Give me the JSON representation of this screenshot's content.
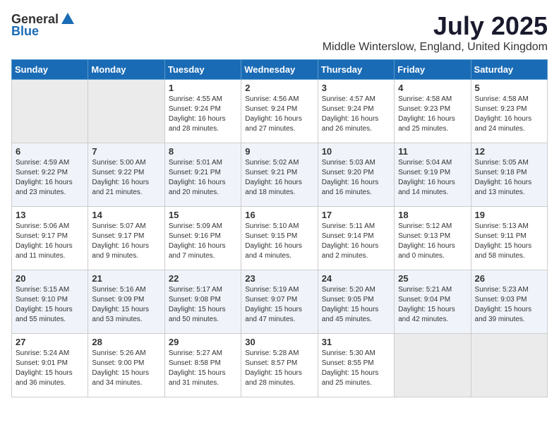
{
  "header": {
    "logo_general": "General",
    "logo_blue": "Blue",
    "month_title": "July 2025",
    "location": "Middle Winterslow, England, United Kingdom"
  },
  "calendar": {
    "days_of_week": [
      "Sunday",
      "Monday",
      "Tuesday",
      "Wednesday",
      "Thursday",
      "Friday",
      "Saturday"
    ],
    "weeks": [
      [
        {
          "day": "",
          "empty": true
        },
        {
          "day": "",
          "empty": true
        },
        {
          "day": "1",
          "sunrise": "Sunrise: 4:55 AM",
          "sunset": "Sunset: 9:24 PM",
          "daylight": "Daylight: 16 hours and 28 minutes."
        },
        {
          "day": "2",
          "sunrise": "Sunrise: 4:56 AM",
          "sunset": "Sunset: 9:24 PM",
          "daylight": "Daylight: 16 hours and 27 minutes."
        },
        {
          "day": "3",
          "sunrise": "Sunrise: 4:57 AM",
          "sunset": "Sunset: 9:24 PM",
          "daylight": "Daylight: 16 hours and 26 minutes."
        },
        {
          "day": "4",
          "sunrise": "Sunrise: 4:58 AM",
          "sunset": "Sunset: 9:23 PM",
          "daylight": "Daylight: 16 hours and 25 minutes."
        },
        {
          "day": "5",
          "sunrise": "Sunrise: 4:58 AM",
          "sunset": "Sunset: 9:23 PM",
          "daylight": "Daylight: 16 hours and 24 minutes."
        }
      ],
      [
        {
          "day": "6",
          "sunrise": "Sunrise: 4:59 AM",
          "sunset": "Sunset: 9:22 PM",
          "daylight": "Daylight: 16 hours and 23 minutes."
        },
        {
          "day": "7",
          "sunrise": "Sunrise: 5:00 AM",
          "sunset": "Sunset: 9:22 PM",
          "daylight": "Daylight: 16 hours and 21 minutes."
        },
        {
          "day": "8",
          "sunrise": "Sunrise: 5:01 AM",
          "sunset": "Sunset: 9:21 PM",
          "daylight": "Daylight: 16 hours and 20 minutes."
        },
        {
          "day": "9",
          "sunrise": "Sunrise: 5:02 AM",
          "sunset": "Sunset: 9:21 PM",
          "daylight": "Daylight: 16 hours and 18 minutes."
        },
        {
          "day": "10",
          "sunrise": "Sunrise: 5:03 AM",
          "sunset": "Sunset: 9:20 PM",
          "daylight": "Daylight: 16 hours and 16 minutes."
        },
        {
          "day": "11",
          "sunrise": "Sunrise: 5:04 AM",
          "sunset": "Sunset: 9:19 PM",
          "daylight": "Daylight: 16 hours and 14 minutes."
        },
        {
          "day": "12",
          "sunrise": "Sunrise: 5:05 AM",
          "sunset": "Sunset: 9:18 PM",
          "daylight": "Daylight: 16 hours and 13 minutes."
        }
      ],
      [
        {
          "day": "13",
          "sunrise": "Sunrise: 5:06 AM",
          "sunset": "Sunset: 9:17 PM",
          "daylight": "Daylight: 16 hours and 11 minutes."
        },
        {
          "day": "14",
          "sunrise": "Sunrise: 5:07 AM",
          "sunset": "Sunset: 9:17 PM",
          "daylight": "Daylight: 16 hours and 9 minutes."
        },
        {
          "day": "15",
          "sunrise": "Sunrise: 5:09 AM",
          "sunset": "Sunset: 9:16 PM",
          "daylight": "Daylight: 16 hours and 7 minutes."
        },
        {
          "day": "16",
          "sunrise": "Sunrise: 5:10 AM",
          "sunset": "Sunset: 9:15 PM",
          "daylight": "Daylight: 16 hours and 4 minutes."
        },
        {
          "day": "17",
          "sunrise": "Sunrise: 5:11 AM",
          "sunset": "Sunset: 9:14 PM",
          "daylight": "Daylight: 16 hours and 2 minutes."
        },
        {
          "day": "18",
          "sunrise": "Sunrise: 5:12 AM",
          "sunset": "Sunset: 9:13 PM",
          "daylight": "Daylight: 16 hours and 0 minutes."
        },
        {
          "day": "19",
          "sunrise": "Sunrise: 5:13 AM",
          "sunset": "Sunset: 9:11 PM",
          "daylight": "Daylight: 15 hours and 58 minutes."
        }
      ],
      [
        {
          "day": "20",
          "sunrise": "Sunrise: 5:15 AM",
          "sunset": "Sunset: 9:10 PM",
          "daylight": "Daylight: 15 hours and 55 minutes."
        },
        {
          "day": "21",
          "sunrise": "Sunrise: 5:16 AM",
          "sunset": "Sunset: 9:09 PM",
          "daylight": "Daylight: 15 hours and 53 minutes."
        },
        {
          "day": "22",
          "sunrise": "Sunrise: 5:17 AM",
          "sunset": "Sunset: 9:08 PM",
          "daylight": "Daylight: 15 hours and 50 minutes."
        },
        {
          "day": "23",
          "sunrise": "Sunrise: 5:19 AM",
          "sunset": "Sunset: 9:07 PM",
          "daylight": "Daylight: 15 hours and 47 minutes."
        },
        {
          "day": "24",
          "sunrise": "Sunrise: 5:20 AM",
          "sunset": "Sunset: 9:05 PM",
          "daylight": "Daylight: 15 hours and 45 minutes."
        },
        {
          "day": "25",
          "sunrise": "Sunrise: 5:21 AM",
          "sunset": "Sunset: 9:04 PM",
          "daylight": "Daylight: 15 hours and 42 minutes."
        },
        {
          "day": "26",
          "sunrise": "Sunrise: 5:23 AM",
          "sunset": "Sunset: 9:03 PM",
          "daylight": "Daylight: 15 hours and 39 minutes."
        }
      ],
      [
        {
          "day": "27",
          "sunrise": "Sunrise: 5:24 AM",
          "sunset": "Sunset: 9:01 PM",
          "daylight": "Daylight: 15 hours and 36 minutes."
        },
        {
          "day": "28",
          "sunrise": "Sunrise: 5:26 AM",
          "sunset": "Sunset: 9:00 PM",
          "daylight": "Daylight: 15 hours and 34 minutes."
        },
        {
          "day": "29",
          "sunrise": "Sunrise: 5:27 AM",
          "sunset": "Sunset: 8:58 PM",
          "daylight": "Daylight: 15 hours and 31 minutes."
        },
        {
          "day": "30",
          "sunrise": "Sunrise: 5:28 AM",
          "sunset": "Sunset: 8:57 PM",
          "daylight": "Daylight: 15 hours and 28 minutes."
        },
        {
          "day": "31",
          "sunrise": "Sunrise: 5:30 AM",
          "sunset": "Sunset: 8:55 PM",
          "daylight": "Daylight: 15 hours and 25 minutes."
        },
        {
          "day": "",
          "empty": true
        },
        {
          "day": "",
          "empty": true
        }
      ]
    ]
  }
}
